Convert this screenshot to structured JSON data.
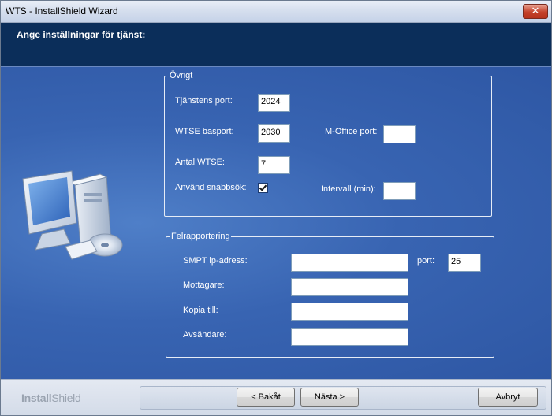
{
  "window": {
    "title": "WTS - InstallShield Wizard",
    "close_glyph": "✕"
  },
  "header": {
    "heading": "Ange inställningar för tjänst:"
  },
  "ovrigt": {
    "legend": "Övrigt",
    "tjanstens_port_label": "Tjänstens port:",
    "tjanstens_port_value": "2024",
    "wtse_basport_label": "WTSE basport:",
    "wtse_basport_value": "2030",
    "moffice_port_label": "M-Office port:",
    "moffice_port_value": "",
    "antal_wtse_label": "Antal WTSE:",
    "antal_wtse_value": "7",
    "snabbsok_label": "Använd snabbsök:",
    "snabbsok_checked": true,
    "intervall_label": "Intervall (min):",
    "intervall_value": ""
  },
  "felrapportering": {
    "legend": "Felrapportering",
    "smpt_label": "SMPT  ip-adress:",
    "smpt_value": "",
    "port_label": "port:",
    "port_value": "25",
    "mottagare_label": "Mottagare:",
    "mottagare_value": "",
    "kopia_label": "Kopia till:",
    "kopia_value": "",
    "avsandare_label": "Avsändare:",
    "avsandare_value": ""
  },
  "footer": {
    "brand_bold": "Install",
    "brand_thin": "Shield",
    "back_label": "< Bakåt",
    "next_label": "Nästa >",
    "cancel_label": "Avbryt"
  }
}
